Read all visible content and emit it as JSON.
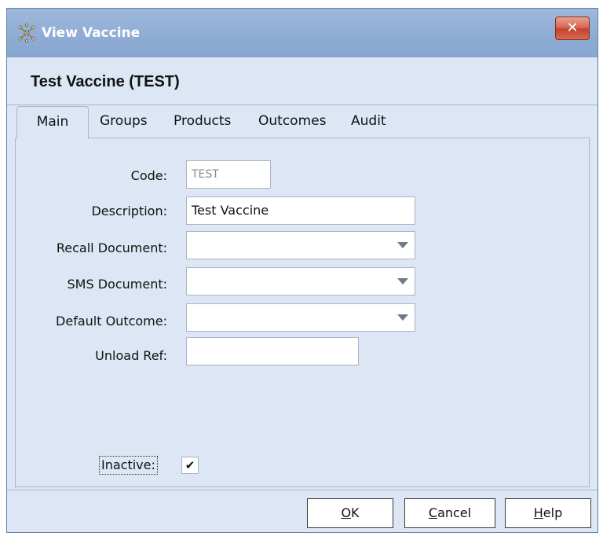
{
  "window": {
    "title": "View Vaccine",
    "close_label": "✕"
  },
  "header": {
    "title": "Test Vaccine (TEST)"
  },
  "tabs": [
    {
      "label": "Main",
      "active": true
    },
    {
      "label": "Groups",
      "active": false
    },
    {
      "label": "Products",
      "active": false
    },
    {
      "label": "Outcomes",
      "active": false
    },
    {
      "label": "Audit",
      "active": false
    }
  ],
  "form": {
    "code": {
      "label": "Code:",
      "value": "TEST"
    },
    "description": {
      "label": "Description:",
      "value": "Test Vaccine"
    },
    "recall_document": {
      "label": "Recall Document:",
      "value": ""
    },
    "sms_document": {
      "label": "SMS Document:",
      "value": ""
    },
    "default_outcome": {
      "label": "Default Outcome:",
      "value": ""
    },
    "unload_ref": {
      "label": "Unload Ref:",
      "value": ""
    },
    "inactive": {
      "label": "Inactive:",
      "checked": true,
      "check_glyph": "✔"
    }
  },
  "buttons": {
    "ok": {
      "mnemonic": "O",
      "rest": "K"
    },
    "cancel": {
      "mnemonic": "C",
      "rest": "ancel"
    },
    "help": {
      "mnemonic": "H",
      "rest": "elp"
    }
  },
  "colors": {
    "titlebar": "#8eabd3",
    "background": "#dce6f4",
    "close_button": "#c4432f"
  }
}
